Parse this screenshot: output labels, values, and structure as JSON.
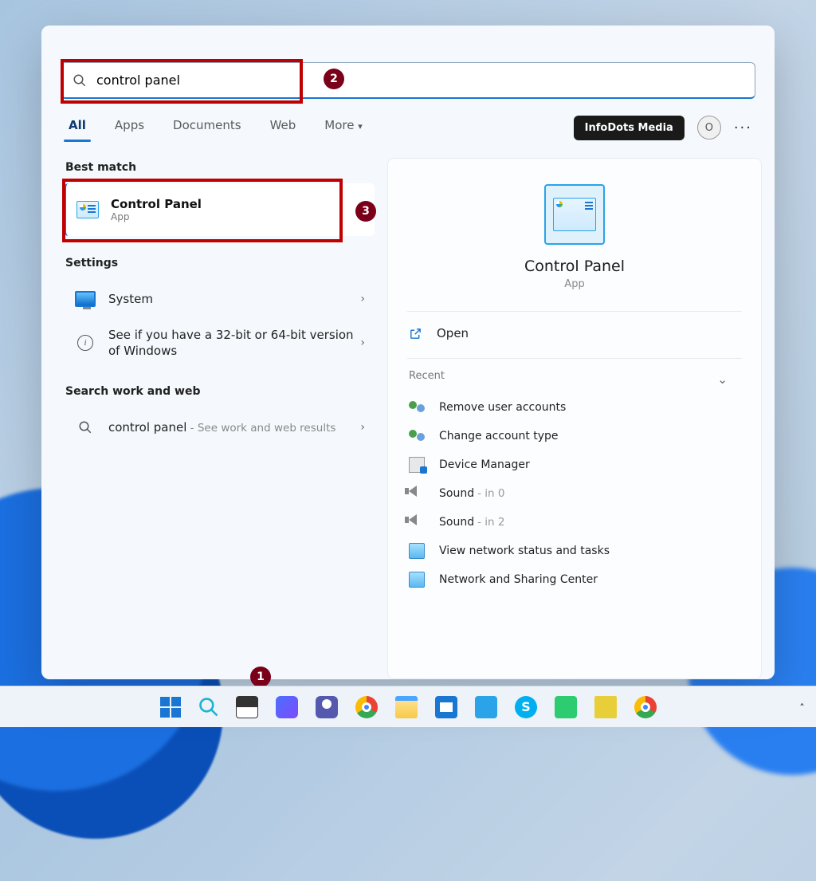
{
  "search": {
    "value": "control panel"
  },
  "tabs": {
    "all": "All",
    "apps": "Apps",
    "documents": "Documents",
    "web": "Web",
    "more": "More"
  },
  "account": {
    "label": "InfoDots Media",
    "initial": "O"
  },
  "left": {
    "best_match": "Best match",
    "best": {
      "title": "Control Panel",
      "sub": "App"
    },
    "settings": "Settings",
    "system": "System",
    "bits": "See if you have a 32-bit or 64-bit version of Windows",
    "sww": "Search work and web",
    "web_query": "control panel",
    "web_sub": " - See work and web results"
  },
  "right": {
    "title": "Control Panel",
    "sub": "App",
    "open": "Open",
    "recent": "Recent",
    "items": [
      {
        "label": "Remove user accounts",
        "suffix": ""
      },
      {
        "label": "Change account type",
        "suffix": ""
      },
      {
        "label": "Device Manager",
        "suffix": ""
      },
      {
        "label": "Sound",
        "suffix": " - in 0"
      },
      {
        "label": "Sound",
        "suffix": " - in 2"
      },
      {
        "label": "View network status and tasks",
        "suffix": ""
      },
      {
        "label": "Network and Sharing Center",
        "suffix": ""
      }
    ]
  },
  "anno": {
    "n1": "1",
    "n2": "2",
    "n3": "3"
  }
}
